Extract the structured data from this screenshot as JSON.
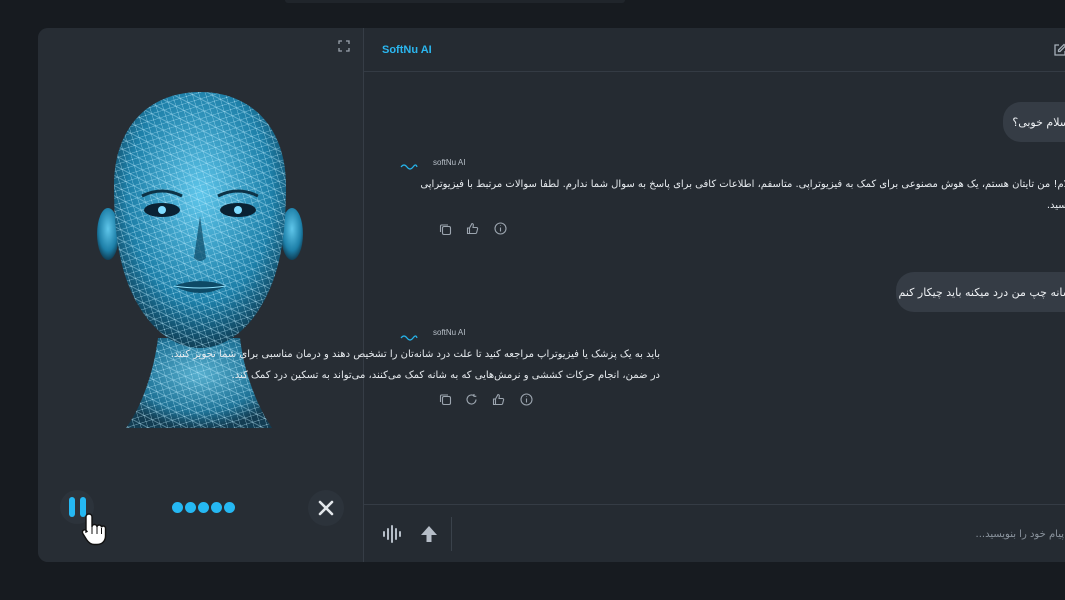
{
  "app": {
    "brand": "SoftNu AI"
  },
  "conversation": {
    "user_messages": [
      {
        "text": "سلام خوبی؟"
      },
      {
        "text": "شانه چپ من درد میکنه باید چیکار کنم"
      }
    ],
    "bot_messages": [
      {
        "sender": "softNu AI",
        "lines": [
          "سلام! من تایتان هستم، یک هوش مصنوعی برای کمک به فیزیوتراپی. متاسفم، اطلاعات کافی برای پاسخ به سوال شما ندارم. لطفا سوالات مرتبط با فیزیوتراپی",
          "بپرسید."
        ]
      },
      {
        "sender": "softNu AI",
        "lines": [
          "باید به یک پزشک یا فیزیوتراپ مراجعه کنید تا علت درد شانه‌تان را تشخیص دهند و درمان مناسبی برای شما تجویز کنند.",
          "در ضمن، انجام حرکات کششی و نرمش‌هایی که به شانه کمک می‌کنند، می‌تواند به تسکین درد کمک کند."
        ]
      }
    ]
  },
  "input": {
    "placeholder": "پیام خود را بنویسید..."
  },
  "theme": {
    "accent": "#25b8f3",
    "panel": "#242a31",
    "bubble": "#353c45"
  }
}
